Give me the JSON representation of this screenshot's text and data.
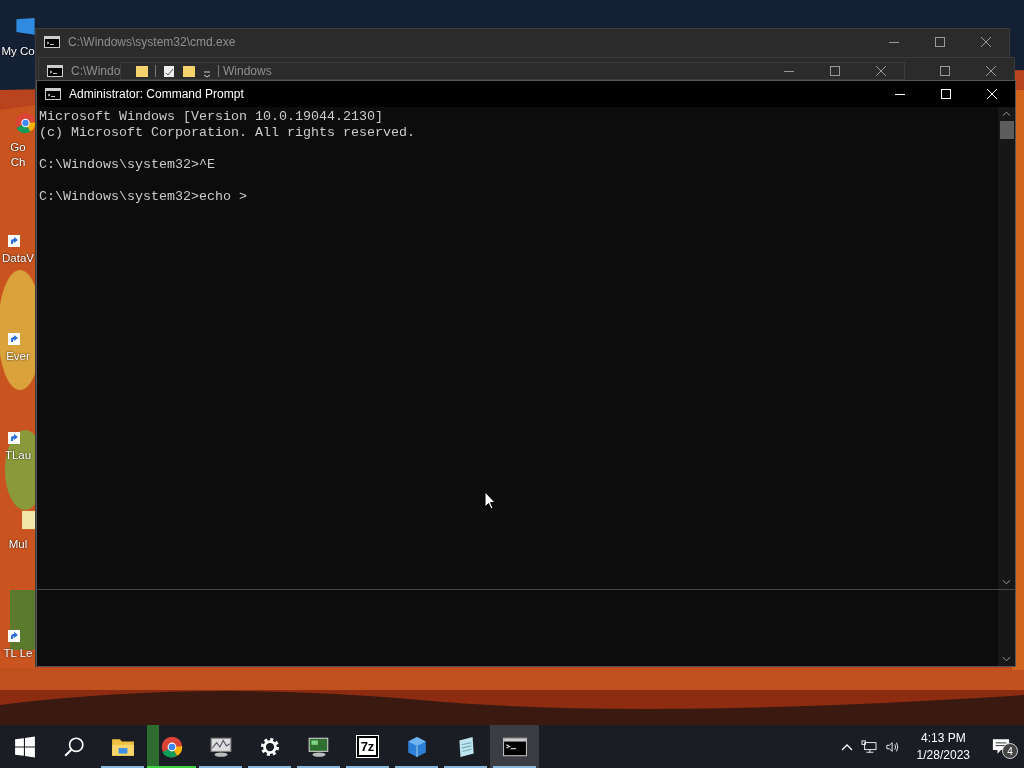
{
  "desktop": {
    "icons": [
      {
        "kind": "computer",
        "lines": [
          "My Co"
        ]
      },
      {
        "kind": "chrome",
        "lines": [
          "Go",
          "Ch"
        ]
      },
      {
        "kind": "shortcut",
        "lines": [
          "DataV"
        ]
      },
      {
        "kind": "shortcut",
        "lines": [
          "Ever"
        ]
      },
      {
        "kind": "shortcut",
        "lines": [
          "TLau"
        ]
      },
      {
        "kind": "file",
        "lines": [
          "Mul"
        ]
      },
      {
        "kind": "shortcut",
        "lines": [
          "TL Le"
        ]
      }
    ]
  },
  "windows": [
    {
      "kind": "console",
      "title": "C:\\Windows\\system32\\cmd.exe",
      "active": false
    },
    {
      "kind": "console",
      "title": "C:\\Windo",
      "active": false
    },
    {
      "kind": "explorer",
      "title": "Windows",
      "active": false
    },
    {
      "kind": "console",
      "title": "Administrator:  Command Prompt",
      "active": true,
      "output": [
        [
          "Microsoft Windows [Version 10.0.19044.2130]",
          "(c) Microsoft Corporation. All rights reserved."
        ],
        [
          "C:\\Windows\\system32>^E"
        ],
        [
          "C:\\Windows\\system32>echo >"
        ]
      ]
    }
  ],
  "taskbar": {
    "items": [
      {
        "kind": "start",
        "running": false,
        "selected": false,
        "attention": false
      },
      {
        "kind": "search",
        "running": false,
        "selected": false,
        "attention": false
      },
      {
        "kind": "folder",
        "running": true,
        "selected": false,
        "attention": false
      },
      {
        "kind": "chrome",
        "running": true,
        "selected": false,
        "attention": true
      },
      {
        "kind": "monitor",
        "running": true,
        "selected": false,
        "attention": false
      },
      {
        "kind": "gear",
        "running": true,
        "selected": false,
        "attention": false
      },
      {
        "kind": "screen",
        "running": true,
        "selected": false,
        "attention": false
      },
      {
        "kind": "archiver",
        "label": "7z",
        "running": true,
        "selected": false,
        "attention": false
      },
      {
        "kind": "cube",
        "running": true,
        "selected": false,
        "attention": false
      },
      {
        "kind": "notepad",
        "running": true,
        "selected": false,
        "attention": false
      },
      {
        "kind": "console",
        "running": true,
        "selected": true,
        "attention": false
      }
    ],
    "tray": {
      "time": "4:13 PM",
      "date": "1/28/2023",
      "notifications": "4"
    }
  }
}
